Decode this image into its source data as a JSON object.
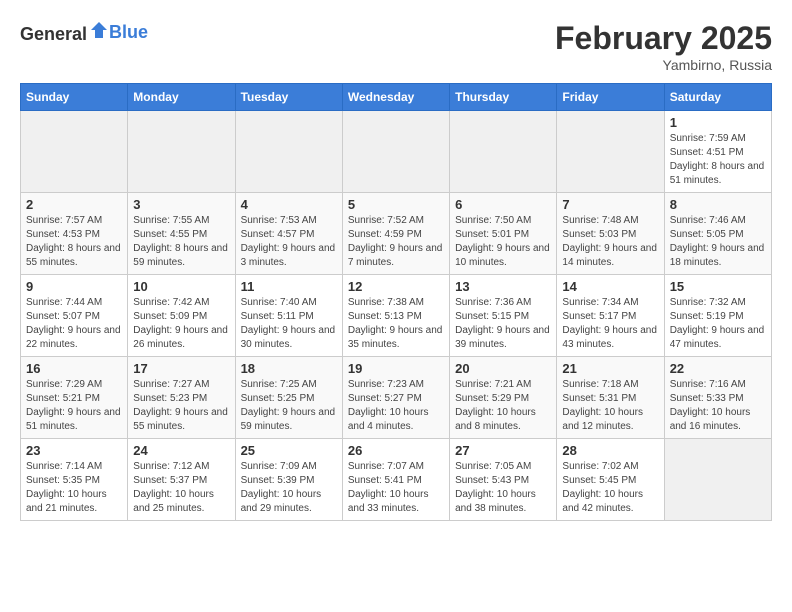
{
  "header": {
    "logo_general": "General",
    "logo_blue": "Blue",
    "month_year": "February 2025",
    "location": "Yambirno, Russia"
  },
  "weekdays": [
    "Sunday",
    "Monday",
    "Tuesday",
    "Wednesday",
    "Thursday",
    "Friday",
    "Saturday"
  ],
  "weeks": [
    [
      {
        "day": "",
        "info": ""
      },
      {
        "day": "",
        "info": ""
      },
      {
        "day": "",
        "info": ""
      },
      {
        "day": "",
        "info": ""
      },
      {
        "day": "",
        "info": ""
      },
      {
        "day": "",
        "info": ""
      },
      {
        "day": "1",
        "info": "Sunrise: 7:59 AM\nSunset: 4:51 PM\nDaylight: 8 hours and 51 minutes."
      }
    ],
    [
      {
        "day": "2",
        "info": "Sunrise: 7:57 AM\nSunset: 4:53 PM\nDaylight: 8 hours and 55 minutes."
      },
      {
        "day": "3",
        "info": "Sunrise: 7:55 AM\nSunset: 4:55 PM\nDaylight: 8 hours and 59 minutes."
      },
      {
        "day": "4",
        "info": "Sunrise: 7:53 AM\nSunset: 4:57 PM\nDaylight: 9 hours and 3 minutes."
      },
      {
        "day": "5",
        "info": "Sunrise: 7:52 AM\nSunset: 4:59 PM\nDaylight: 9 hours and 7 minutes."
      },
      {
        "day": "6",
        "info": "Sunrise: 7:50 AM\nSunset: 5:01 PM\nDaylight: 9 hours and 10 minutes."
      },
      {
        "day": "7",
        "info": "Sunrise: 7:48 AM\nSunset: 5:03 PM\nDaylight: 9 hours and 14 minutes."
      },
      {
        "day": "8",
        "info": "Sunrise: 7:46 AM\nSunset: 5:05 PM\nDaylight: 9 hours and 18 minutes."
      }
    ],
    [
      {
        "day": "9",
        "info": "Sunrise: 7:44 AM\nSunset: 5:07 PM\nDaylight: 9 hours and 22 minutes."
      },
      {
        "day": "10",
        "info": "Sunrise: 7:42 AM\nSunset: 5:09 PM\nDaylight: 9 hours and 26 minutes."
      },
      {
        "day": "11",
        "info": "Sunrise: 7:40 AM\nSunset: 5:11 PM\nDaylight: 9 hours and 30 minutes."
      },
      {
        "day": "12",
        "info": "Sunrise: 7:38 AM\nSunset: 5:13 PM\nDaylight: 9 hours and 35 minutes."
      },
      {
        "day": "13",
        "info": "Sunrise: 7:36 AM\nSunset: 5:15 PM\nDaylight: 9 hours and 39 minutes."
      },
      {
        "day": "14",
        "info": "Sunrise: 7:34 AM\nSunset: 5:17 PM\nDaylight: 9 hours and 43 minutes."
      },
      {
        "day": "15",
        "info": "Sunrise: 7:32 AM\nSunset: 5:19 PM\nDaylight: 9 hours and 47 minutes."
      }
    ],
    [
      {
        "day": "16",
        "info": "Sunrise: 7:29 AM\nSunset: 5:21 PM\nDaylight: 9 hours and 51 minutes."
      },
      {
        "day": "17",
        "info": "Sunrise: 7:27 AM\nSunset: 5:23 PM\nDaylight: 9 hours and 55 minutes."
      },
      {
        "day": "18",
        "info": "Sunrise: 7:25 AM\nSunset: 5:25 PM\nDaylight: 9 hours and 59 minutes."
      },
      {
        "day": "19",
        "info": "Sunrise: 7:23 AM\nSunset: 5:27 PM\nDaylight: 10 hours and 4 minutes."
      },
      {
        "day": "20",
        "info": "Sunrise: 7:21 AM\nSunset: 5:29 PM\nDaylight: 10 hours and 8 minutes."
      },
      {
        "day": "21",
        "info": "Sunrise: 7:18 AM\nSunset: 5:31 PM\nDaylight: 10 hours and 12 minutes."
      },
      {
        "day": "22",
        "info": "Sunrise: 7:16 AM\nSunset: 5:33 PM\nDaylight: 10 hours and 16 minutes."
      }
    ],
    [
      {
        "day": "23",
        "info": "Sunrise: 7:14 AM\nSunset: 5:35 PM\nDaylight: 10 hours and 21 minutes."
      },
      {
        "day": "24",
        "info": "Sunrise: 7:12 AM\nSunset: 5:37 PM\nDaylight: 10 hours and 25 minutes."
      },
      {
        "day": "25",
        "info": "Sunrise: 7:09 AM\nSunset: 5:39 PM\nDaylight: 10 hours and 29 minutes."
      },
      {
        "day": "26",
        "info": "Sunrise: 7:07 AM\nSunset: 5:41 PM\nDaylight: 10 hours and 33 minutes."
      },
      {
        "day": "27",
        "info": "Sunrise: 7:05 AM\nSunset: 5:43 PM\nDaylight: 10 hours and 38 minutes."
      },
      {
        "day": "28",
        "info": "Sunrise: 7:02 AM\nSunset: 5:45 PM\nDaylight: 10 hours and 42 minutes."
      },
      {
        "day": "",
        "info": ""
      }
    ]
  ]
}
